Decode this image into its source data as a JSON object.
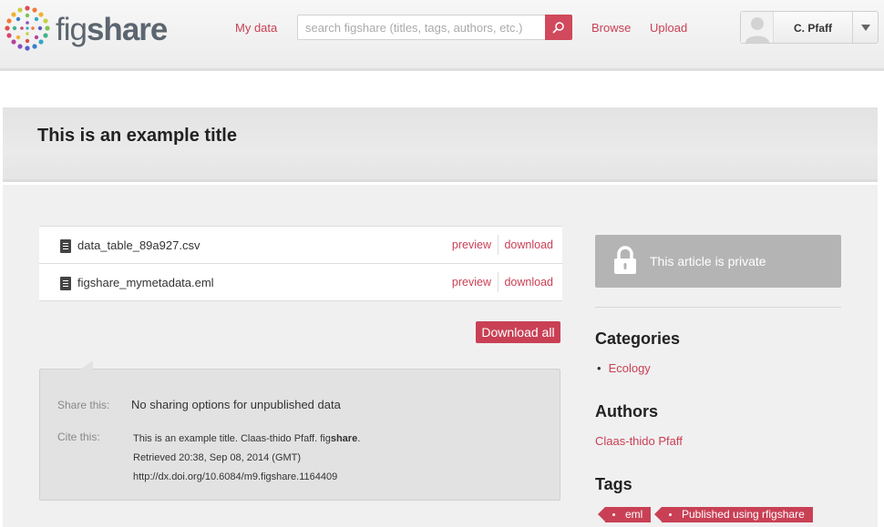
{
  "header": {
    "logo_text": "figshare",
    "logo_text_light": "fig",
    "logo_text_bold": "share",
    "my_data_label": "My data",
    "search_placeholder": "search figshare (titles, tags, authors, etc.)",
    "browse_label": "Browse",
    "upload_label": "Upload",
    "user_name": "C. Pfaff"
  },
  "article": {
    "title": "This is an example title",
    "files": [
      {
        "name": "data_table_89a927.csv",
        "preview_label": "preview",
        "download_label": "download"
      },
      {
        "name": "figshare_mymetadata.eml",
        "preview_label": "preview",
        "download_label": "download"
      }
    ],
    "download_all_label": "Download all",
    "share": {
      "label": "Share this:",
      "value": "No sharing options for unpublished data"
    },
    "cite": {
      "label": "Cite this:",
      "line1_prefix": "This is an example title. Claas-thido Pfaff. fig",
      "line1_bold": "share",
      "line1_suffix": ".",
      "line2": "Retrieved 20:38, Sep 08, 2014 (GMT)",
      "line3": "http://dx.doi.org/10.6084/m9.figshare.1164409"
    }
  },
  "sidebar": {
    "private_text": "This article is private",
    "categories_title": "Categories",
    "categories": [
      "Ecology"
    ],
    "authors_title": "Authors",
    "authors": [
      "Claas-thido Pfaff"
    ],
    "tags_title": "Tags",
    "tags": [
      "eml",
      "Published using rfigshare"
    ]
  },
  "colors": {
    "accent": "#c94055",
    "private_box": "#b4b4b4"
  },
  "icons": [
    "figshare-logo",
    "search-icon",
    "user-avatar-icon",
    "caret-down-icon",
    "file-icon",
    "lock-icon"
  ]
}
